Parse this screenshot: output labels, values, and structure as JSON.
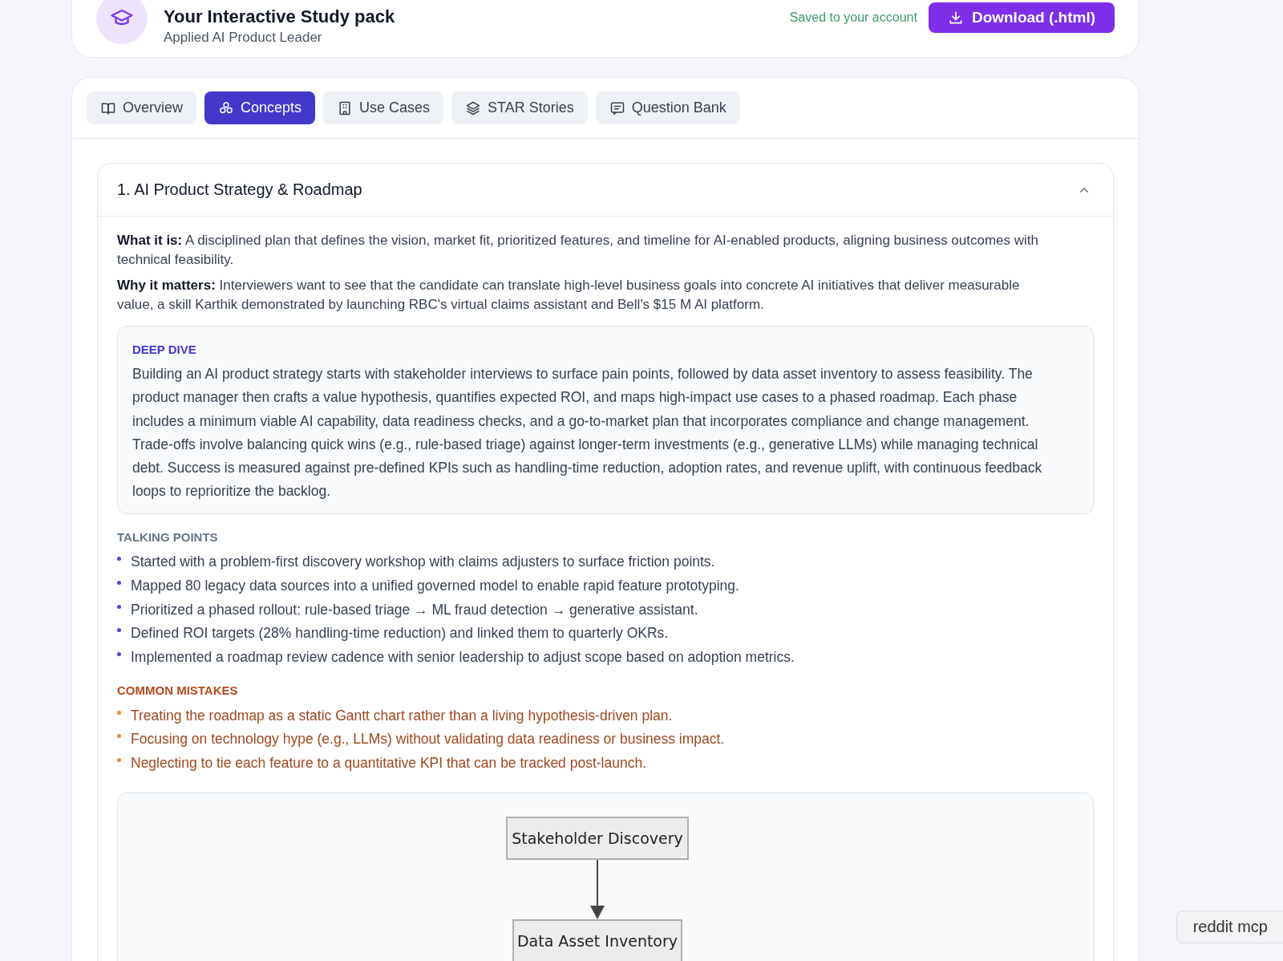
{
  "header": {
    "title": "Your Interactive Study pack",
    "subtitle": "Applied AI Product Leader",
    "status": "Saved to your account",
    "download_button": "Download (.html)"
  },
  "tabs": [
    {
      "label": "Overview",
      "selected": false
    },
    {
      "label": "Concepts",
      "selected": true
    },
    {
      "label": "Use Cases",
      "selected": false
    },
    {
      "label": "STAR Stories",
      "selected": false
    },
    {
      "label": "Question Bank",
      "selected": false
    }
  ],
  "concept": {
    "title": "1. AI Product Strategy & Roadmap",
    "expanded": true,
    "what_it_is": "**What it is:** A disciplined plan that defines the vision, market fit, prioritized features, and timeline for AI-enabled products, aligning business outcomes with technical feasibility.",
    "why_it_matters": "**Why it matters:** Interviewers want to see that the candidate can translate high-level business goals into concrete AI initiatives that deliver measurable value, a skill Karthik demonstrated by launching RBC's virtual claims assistant and Bell's $15 M AI platform.",
    "deep_dive": {
      "label": "DEEP DIVE",
      "text": "Building an AI product strategy starts with stakeholder interviews to surface pain points, followed by data asset inventory to assess feasibility. The product manager then crafts a value hypothesis, quantifies expected ROI, and maps high-impact use cases to a phased roadmap. Each phase includes a minimum viable AI capability, data readiness checks, and a go-to-market plan that incorporates compliance and change management. Trade-offs involve balancing quick wins (e.g., rule-based triage) against longer-term investments (e.g., generative LLMs) while managing technical debt. Success is measured against pre-defined KPIs such as handling-time reduction, adoption rates, and revenue uplift, with continuous feedback loops to reprioritize the backlog."
    },
    "talking_points": {
      "label": "TALKING POINTS",
      "items": [
        "Started with a problem-first discovery workshop with claims adjusters to surface friction points.",
        "Mapped 80 legacy data sources into a unified governed model to enable rapid feature prototyping.",
        "Prioritized a phased rollout: rule-based triage → ML fraud detection → generative assistant.",
        "Defined ROI targets (28% handling-time reduction) and linked them to quarterly OKRs.",
        "Implemented a roadmap review cadence with senior leadership to adjust scope based on adoption metrics."
      ]
    },
    "common_mistakes": {
      "label": "COMMON MISTAKES",
      "items": [
        "Treating the roadmap as a static Gantt chart rather than a living hypothesis-driven plan.",
        "Focusing on technology hype (e.g., LLMs) without validating data readiness or business impact.",
        "Neglecting to tie each feature to a quantitative KPI that can be tracked post-launch."
      ]
    },
    "diagram": {
      "nodes": [
        "Stakeholder Discovery",
        "Data Asset Inventory"
      ]
    }
  },
  "floating_button": "reddit mcp"
}
